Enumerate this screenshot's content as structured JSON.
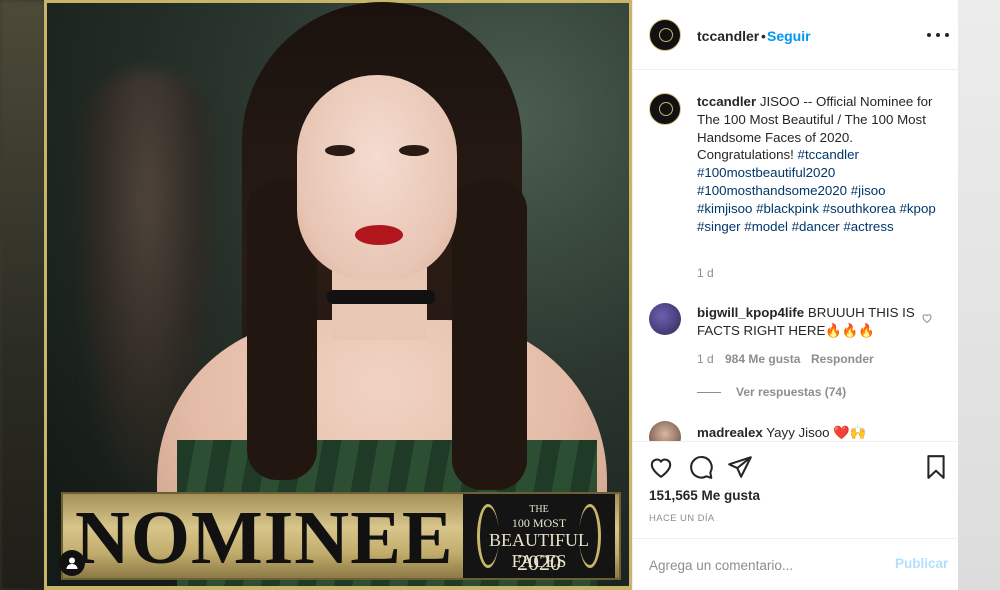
{
  "post": {
    "username": "tccandler",
    "follow_label": "Seguir",
    "dot": "•",
    "image": {
      "banner_text": "NOMINEE",
      "badge": {
        "line1": "THE",
        "line2": "100 MOST",
        "line3": "BEAUTIFUL FACES",
        "line4": "2020"
      }
    }
  },
  "caption": {
    "username": "tccandler",
    "text": "JISOO -- Official Nominee for The 100 Most Beautiful / The 100 Most Handsome Faces of 2020. Congratulations!",
    "hashtags": "#tccandler #100mostbeautiful2020 #100mosthandsome2020 #jisoo #kimjisoo #blackpink #southkorea #kpop #singer #model #dancer #actress",
    "age": "1 d"
  },
  "comments": [
    {
      "username": "bigwill_kpop4life",
      "text": "BRUUUH THIS IS FACTS RIGHT HERE🔥🔥🔥",
      "age": "1 d",
      "likes": "984 Me gusta",
      "reply_label": "Responder",
      "view_replies": "Ver respuestas (74)"
    },
    {
      "username": "madrealex",
      "text": "Yayy Jisoo ❤️🙌"
    }
  ],
  "actions": {
    "likes": "151,565 Me gusta",
    "timestamp": "HACE UN DÍA",
    "comment_placeholder": "Agrega un comentario...",
    "publish_label": "Publicar"
  },
  "icons": [
    "more-icon",
    "heart-icon",
    "comment-icon",
    "share-icon",
    "bookmark-icon",
    "user-tag-icon"
  ],
  "colors": {
    "link_blue": "#0095f6",
    "publish_disabled": "#b2dffc",
    "gold_frame": "#c9b56a"
  }
}
